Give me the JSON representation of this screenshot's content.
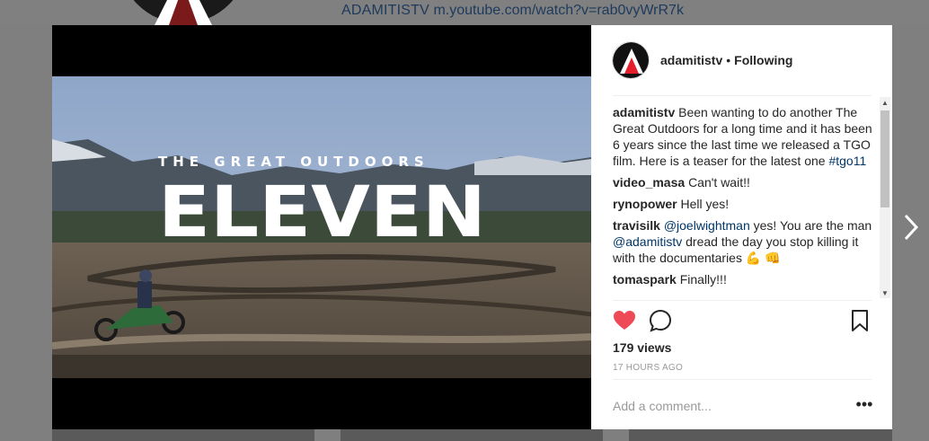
{
  "background": {
    "site_name": "ADAMITISTV",
    "url": "m.youtube.com/watch?v=rab0vyWrR7k"
  },
  "video": {
    "title_top": "THE GREAT OUTDOORS",
    "title_main": "ELEVEN"
  },
  "post": {
    "username": "adamitistv",
    "separator": "•",
    "follow_status": "Following",
    "caption_user": "adamitistv",
    "caption_text": "Been wanting to do another The Great Outdoors for a long time and it has been 6 years since the last time we released a TGO film. Here is a teaser for the latest one",
    "caption_hashtag": "#tgo11",
    "comments": [
      {
        "user": "video_masa",
        "text": "Can't wait!!"
      },
      {
        "user": "rynopower",
        "text": "Hell yes!"
      },
      {
        "user": "travisilk",
        "mention1": "@joelwightman",
        "text1": "yes! You are the man",
        "mention2": "@adamitistv",
        "text2": "dread the day you stop killing it with the documentaries 💪 👊"
      },
      {
        "user": "tomaspark",
        "text": "Finally!!!"
      }
    ],
    "views": "179 views",
    "timestamp": "17 HOURS AGO",
    "comment_placeholder": "Add a comment...",
    "more_label": "•••"
  },
  "colors": {
    "like": "#ed4956",
    "logo_red": "#e3202b",
    "link": "#003569"
  },
  "icons": [
    "heart-icon",
    "comment-icon",
    "bookmark-icon",
    "next-arrow-icon",
    "ellipsis-icon"
  ]
}
